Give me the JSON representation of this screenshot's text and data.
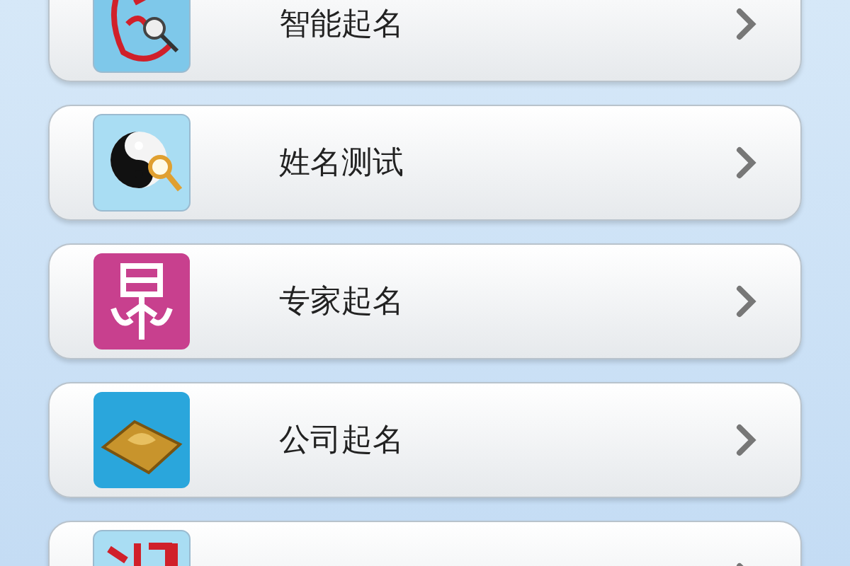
{
  "menu_items": [
    {
      "kind": "brush",
      "label": "智能起名"
    },
    {
      "kind": "yinyang",
      "label": "姓名测试"
    },
    {
      "kind": "seal",
      "label": "专家起名"
    },
    {
      "kind": "board",
      "label": "公司起名"
    },
    {
      "kind": "stamp"
    }
  ]
}
